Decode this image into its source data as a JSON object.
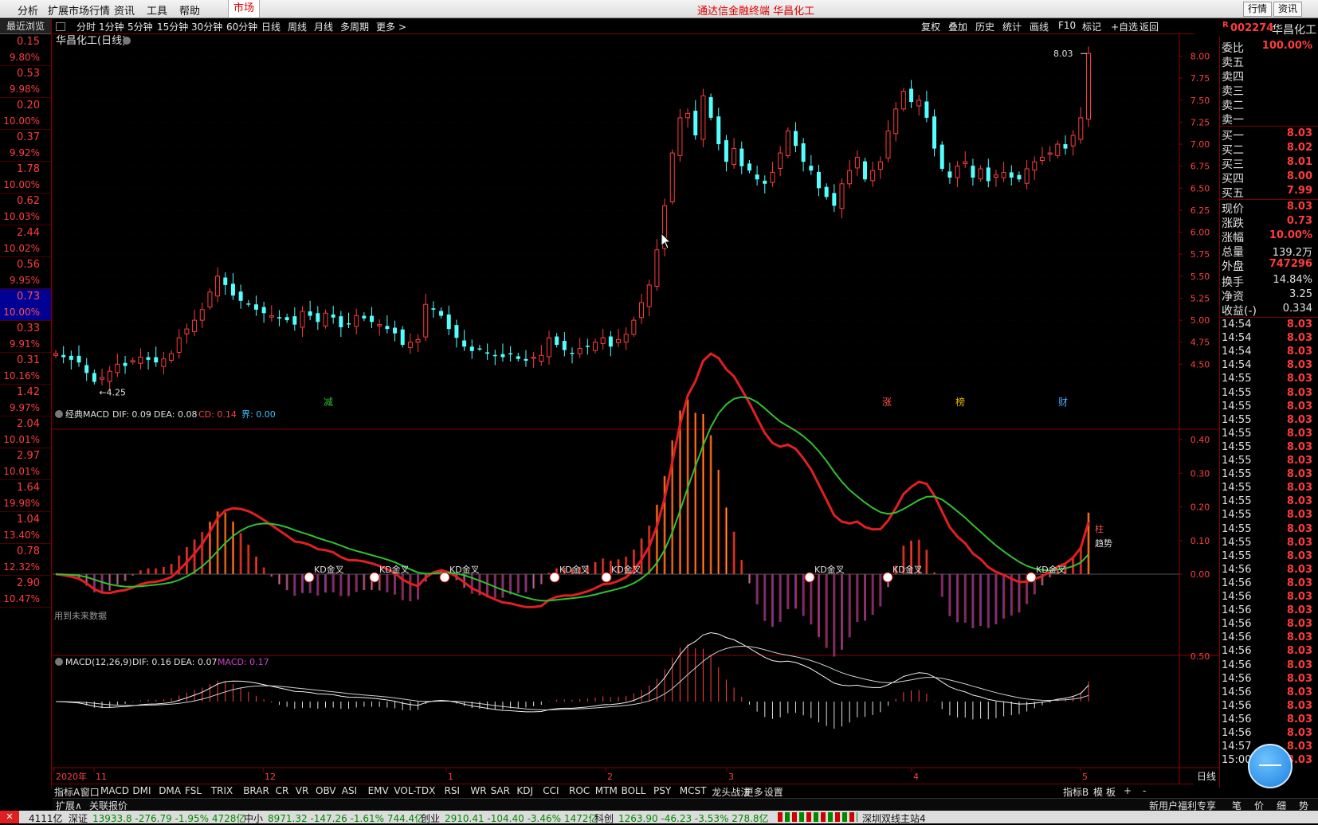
{
  "menu": {
    "items": [
      "分析",
      "扩展市场行情",
      "资讯",
      "工具",
      "帮助"
    ],
    "market_tab": "市场",
    "app_title": "通达信金融终端  华昌化工",
    "right_buttons": [
      "行情",
      "资讯"
    ]
  },
  "periods": [
    "分时",
    "1分钟",
    "5分钟",
    "15分钟",
    "30分钟",
    "60分钟",
    "日线",
    "周线",
    "月线",
    "多周期",
    "更多 >"
  ],
  "tools": [
    "复权",
    "叠加",
    "历史",
    "统计",
    "画线",
    "F10",
    "标记",
    "+自选",
    "返回"
  ],
  "recent": {
    "title": "最近浏览",
    "items": [
      {
        "v": "0.15",
        "p": "9.80%"
      },
      {
        "v": "0.53",
        "p": "9.98%"
      },
      {
        "v": "0.20",
        "p": "10.00%"
      },
      {
        "v": "0.37",
        "p": "9.92%"
      },
      {
        "v": "1.78",
        "p": "10.00%"
      },
      {
        "v": "0.62",
        "p": "10.03%"
      },
      {
        "v": "2.44",
        "p": "10.02%"
      },
      {
        "v": "0.56",
        "p": "9.95%"
      },
      {
        "v": "0.73",
        "p": "10.00%"
      },
      {
        "v": "0.33",
        "p": "9.91%"
      },
      {
        "v": "0.31",
        "p": "10.16%"
      },
      {
        "v": "1.42",
        "p": "9.97%"
      },
      {
        "v": "2.04",
        "p": "10.01%"
      },
      {
        "v": "2.97",
        "p": "10.01%"
      },
      {
        "v": "1.64",
        "p": "19.98%"
      },
      {
        "v": "1.04",
        "p": "13.40%"
      },
      {
        "v": "0.78",
        "p": "12.32%"
      },
      {
        "v": "2.90",
        "p": "10.47%"
      }
    ]
  },
  "stock": {
    "code": "002274",
    "name": "华昌化工",
    "chart_title": "华昌化工(日线)"
  },
  "quote": {
    "wb_label": "委比",
    "wb_value": "100.00%",
    "asks": [
      "卖五",
      "卖四",
      "卖三",
      "卖二",
      "卖一"
    ],
    "bids": [
      {
        "l": "买一",
        "v": "8.03"
      },
      {
        "l": "买二",
        "v": "8.02"
      },
      {
        "l": "买三",
        "v": "8.01"
      },
      {
        "l": "买四",
        "v": "8.00"
      },
      {
        "l": "买五",
        "v": "7.99"
      }
    ],
    "stats": [
      {
        "l": "现价",
        "v": "8.03",
        "c": "red"
      },
      {
        "l": "涨跌",
        "v": "0.73",
        "c": "red"
      },
      {
        "l": "涨幅",
        "v": "10.00%",
        "c": "red"
      },
      {
        "l": "总量",
        "v": "139.2万",
        "c": "white"
      },
      {
        "l": "外盘",
        "v": "747296",
        "c": "red"
      },
      {
        "l": "换手",
        "v": "14.84%",
        "c": "white"
      },
      {
        "l": "净资",
        "v": "3.25",
        "c": "white"
      },
      {
        "l": "收益(-)",
        "v": "0.334",
        "c": "white"
      }
    ],
    "ticks": [
      {
        "t": "14:54",
        "p": "8.03"
      },
      {
        "t": "14:54",
        "p": "8.03"
      },
      {
        "t": "14:54",
        "p": "8.03"
      },
      {
        "t": "14:54",
        "p": "8.03"
      },
      {
        "t": "14:55",
        "p": "8.03"
      },
      {
        "t": "14:55",
        "p": "8.03"
      },
      {
        "t": "14:55",
        "p": "8.03"
      },
      {
        "t": "14:55",
        "p": "8.03"
      },
      {
        "t": "14:55",
        "p": "8.03"
      },
      {
        "t": "14:55",
        "p": "8.03"
      },
      {
        "t": "14:55",
        "p": "8.03"
      },
      {
        "t": "14:55",
        "p": "8.03"
      },
      {
        "t": "14:55",
        "p": "8.03"
      },
      {
        "t": "14:55",
        "p": "8.03"
      },
      {
        "t": "14:55",
        "p": "8.03"
      },
      {
        "t": "14:55",
        "p": "8.03"
      },
      {
        "t": "14:55",
        "p": "8.03"
      },
      {
        "t": "14:55",
        "p": "8.03"
      },
      {
        "t": "14:56",
        "p": "8.03"
      },
      {
        "t": "14:56",
        "p": "8.03"
      },
      {
        "t": "14:56",
        "p": "8.03"
      },
      {
        "t": "14:56",
        "p": "8.03"
      },
      {
        "t": "14:56",
        "p": "8.03"
      },
      {
        "t": "14:56",
        "p": "8.03"
      },
      {
        "t": "14:56",
        "p": "8.03"
      },
      {
        "t": "14:56",
        "p": "8.03"
      },
      {
        "t": "14:56",
        "p": "8.03"
      },
      {
        "t": "14:56",
        "p": "8.03"
      },
      {
        "t": "14:56",
        "p": "8.03"
      },
      {
        "t": "14:56",
        "p": "8.03"
      },
      {
        "t": "14:56",
        "p": "8.03"
      },
      {
        "t": "14:57",
        "p": "8.03"
      },
      {
        "t": "15:00",
        "p": "8.03"
      }
    ]
  },
  "price_axis": [
    "8.00",
    "7.75",
    "7.50",
    "7.25",
    "7.00",
    "6.75",
    "6.50",
    "6.25",
    "6.00",
    "5.75",
    "5.50",
    "5.25",
    "5.00",
    "4.75",
    "4.50"
  ],
  "price_labels": {
    "high": "8.03",
    "low": "4.25"
  },
  "events": [
    "减",
    "涨",
    "榜",
    "财"
  ],
  "macd1": {
    "name": "经典MACD",
    "dif": "DIF: 0.09",
    "dea": "DEA: 0.08",
    "cd": "CD: 0.14",
    "jie": "界: 0.00",
    "axis": [
      "0.40",
      "0.30",
      "0.20",
      "0.10",
      "0.00"
    ],
    "note": "用到未来数据",
    "trend": "趋势",
    "bar_label": "柱",
    "kd": "KD金叉"
  },
  "macd2": {
    "name": "MACD(12,26,9)",
    "dif": "DIF: 0.16",
    "dea": "DEA: 0.07",
    "macd": "MACD: 0.17",
    "axis": [
      "0.50"
    ]
  },
  "dates": [
    "2020年",
    "11",
    "12",
    "1",
    "2",
    "3",
    "4",
    "5"
  ],
  "period_label": "日线",
  "indicators": [
    "指标A",
    "窗口",
    "MACD",
    "DMI",
    "DMA",
    "FSL",
    "TRIX",
    "BRAR",
    "CR",
    "VR",
    "OBV",
    "ASI",
    "EMV",
    "VOL-TDX",
    "RSI",
    "WR",
    "SAR",
    "KDJ",
    "CCI",
    "ROC",
    "MTM",
    "BOLL",
    "PSY",
    "MCST",
    "龙头战法",
    "更多",
    "设置"
  ],
  "ind_right": [
    "指标B",
    "模",
    "板",
    "+",
    "-"
  ],
  "ext": [
    "扩展∧",
    "关联报价"
  ],
  "ext_right": [
    "新用户福利专享",
    "笔",
    "价",
    "细",
    "势"
  ],
  "status": [
    {
      "t": "4111亿",
      "c": "#111"
    },
    {
      "t": "深证",
      "c": "#111"
    },
    {
      "t": "13933.8 -276.79 -1.95% 4728亿",
      "c": "#008a00"
    },
    {
      "t": "中小",
      "c": "#111"
    },
    {
      "t": "8971.32 -147.26 -1.61% 744.4亿",
      "c": "#008a00"
    },
    {
      "t": "创业",
      "c": "#111"
    },
    {
      "t": "2910.41 -104.40 -3.46% 1472亿",
      "c": "#008a00"
    },
    {
      "t": "科创",
      "c": "#111"
    },
    {
      "t": "1263.90 -46.23 -3.53% 278.8亿",
      "c": "#008a00"
    },
    {
      "t": "深圳双线主站4",
      "c": "#111"
    }
  ],
  "chart_data": {
    "type": "candlestick",
    "title": "华昌化工(日线)",
    "ylim": [
      4.25,
      8.03
    ],
    "close": [
      4.62,
      4.58,
      4.55,
      4.52,
      4.4,
      4.3,
      4.35,
      4.42,
      4.5,
      4.48,
      4.54,
      4.58,
      4.55,
      4.52,
      4.56,
      4.62,
      4.8,
      4.9,
      5.0,
      5.12,
      5.32,
      5.5,
      5.4,
      5.28,
      5.22,
      5.18,
      5.12,
      5.08,
      5.05,
      5.02,
      5.0,
      4.95,
      5.1,
      5.05,
      4.98,
      5.08,
      5.03,
      4.92,
      4.96,
      5.05,
      5.02,
      4.98,
      4.95,
      4.9,
      4.85,
      4.72,
      4.75,
      4.78,
      5.18,
      5.12,
      5.05,
      4.9,
      4.8,
      4.7,
      4.65,
      4.68,
      4.62,
      4.6,
      4.58,
      4.62,
      4.56,
      4.54,
      4.58,
      4.6,
      4.8,
      4.72,
      4.66,
      4.62,
      4.68,
      4.7,
      4.75,
      4.8,
      4.7,
      4.78,
      4.84,
      5.0,
      5.2,
      5.4,
      5.8,
      6.3,
      6.9,
      7.3,
      7.35,
      7.1,
      7.55,
      7.3,
      7.0,
      6.8,
      6.95,
      6.75,
      6.7,
      6.6,
      6.55,
      6.68,
      6.9,
      7.15,
      6.98,
      6.8,
      6.7,
      6.5,
      6.4,
      6.3,
      6.55,
      6.7,
      6.85,
      6.6,
      6.7,
      6.8,
      7.15,
      7.4,
      7.6,
      7.48,
      7.5,
      7.3,
      6.95,
      6.72,
      6.62,
      6.75,
      6.8,
      6.62,
      6.72,
      6.58,
      6.65,
      6.68,
      6.62,
      6.6,
      6.72,
      6.8,
      6.85,
      6.9,
      7.0,
      6.95,
      7.1,
      7.3,
      8.03
    ]
  }
}
